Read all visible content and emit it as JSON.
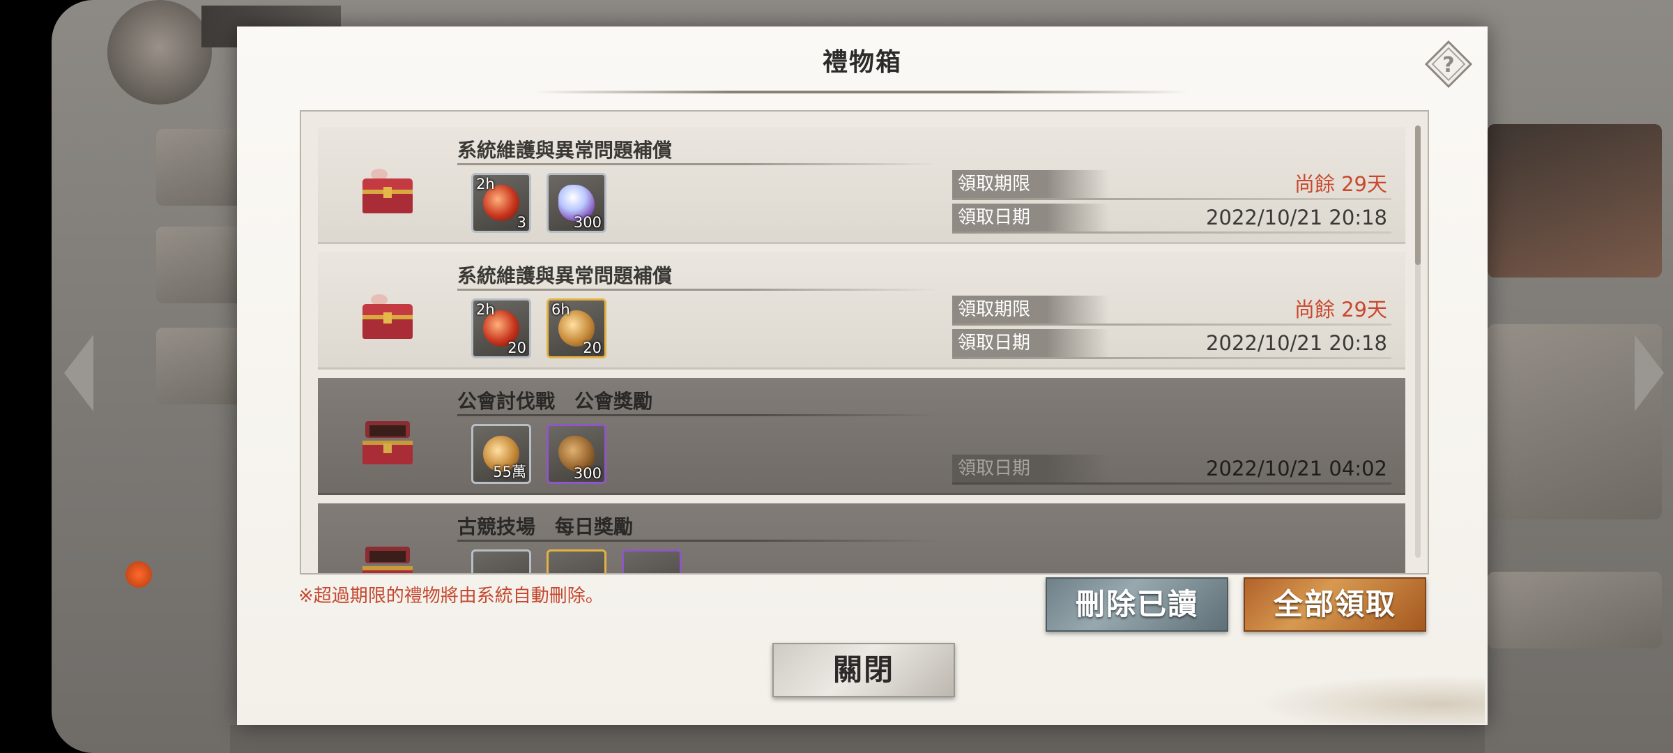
{
  "modal": {
    "title": "禮物箱",
    "note": "※超過期限的禮物將由系統自動刪除。",
    "buttons": {
      "delete_read": "刪除已讀",
      "claim_all": "全部領取",
      "close": "關閉"
    }
  },
  "labels": {
    "deadline": "領取期限",
    "date": "領取日期"
  },
  "gifts": [
    {
      "title": "系統維護與異常問題補償",
      "status": "unread",
      "rewards": [
        {
          "icon": "red-orb-icon",
          "time": "2h",
          "qty": "3",
          "frame": "silver"
        },
        {
          "icon": "crystal-icon",
          "time": "",
          "qty": "300",
          "frame": "silver"
        }
      ],
      "deadline": "尚餘 29天",
      "date": "2022/10/21 20:18"
    },
    {
      "title": "系統維護與異常問題補償",
      "status": "unread",
      "rewards": [
        {
          "icon": "red-orb-icon",
          "time": "2h",
          "qty": "20",
          "frame": "silver"
        },
        {
          "icon": "gold-coin-icon",
          "time": "6h",
          "qty": "20",
          "frame": "gold"
        }
      ],
      "deadline": "尚餘 29天",
      "date": "2022/10/21 20:18"
    },
    {
      "title": "公會討伐戰　公會獎勵",
      "status": "read",
      "rewards": [
        {
          "icon": "bronze-coin-icon",
          "time": "",
          "qty": "55萬",
          "frame": "silver"
        },
        {
          "icon": "ore-icon",
          "time": "",
          "qty": "300",
          "frame": "purple"
        }
      ],
      "deadline": "",
      "date": "2022/10/21 04:02"
    },
    {
      "title": "古競技場　每日獎勵",
      "status": "read",
      "rewards": [],
      "deadline": "",
      "date": ""
    }
  ],
  "colors": {
    "expire_text": "#c9472e",
    "claim_button": "#d79950",
    "delete_button": "#97a9af",
    "note_text": "#c4482f"
  }
}
